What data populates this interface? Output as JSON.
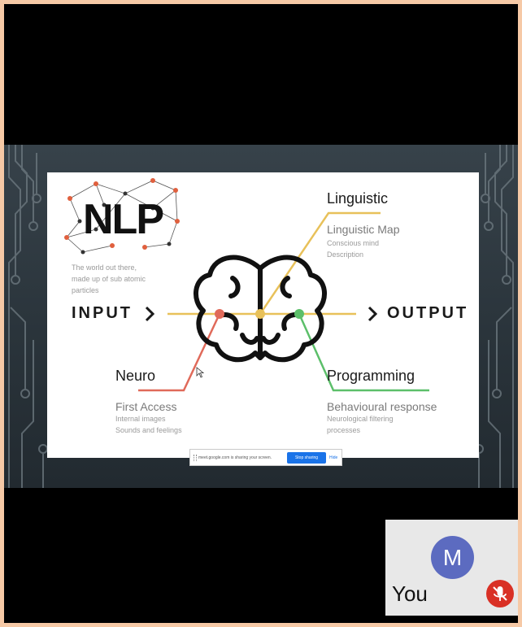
{
  "slide": {
    "logo": "NLP",
    "world_line1": "The world out there,",
    "world_line2": "made up of sub atomic",
    "world_line3": "particles",
    "input_label": "INPUT",
    "output_label": "OUTPUT",
    "linguistic": {
      "title": "Linguistic",
      "subtitle": "Linguistic Map",
      "line1": "Conscious mind",
      "line2": "Description"
    },
    "neuro": {
      "title": "Neuro",
      "subtitle": "First Access",
      "line1": "Internal images",
      "line2": "Sounds and feelings"
    },
    "programming": {
      "title": "Programming",
      "subtitle": "Behavioural response",
      "line1": "Neurological filtering",
      "line2": "processes"
    },
    "colors": {
      "neuro": "#e06a5a",
      "linguistic": "#e8c15a",
      "programming": "#5cbf6a"
    }
  },
  "share_bar": {
    "message": "meet.google.com is sharing your screen.",
    "stop_label": "Stop sharing",
    "hide_label": "Hide"
  },
  "participant": {
    "initial": "M",
    "label": "You",
    "mic_state": "muted",
    "avatar_color": "#5c6bc0"
  }
}
